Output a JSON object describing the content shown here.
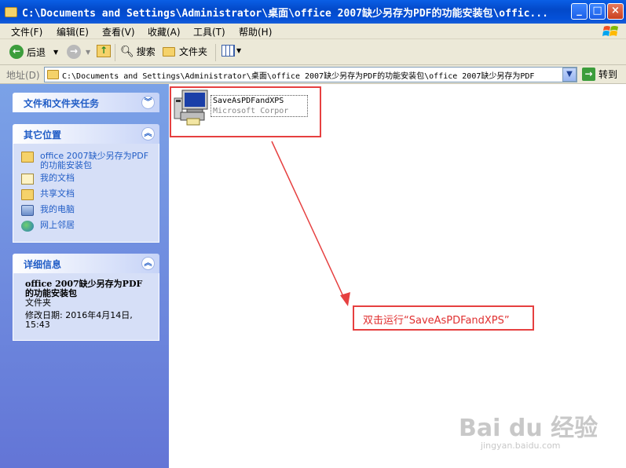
{
  "window": {
    "title": "C:\\Documents and Settings\\Administrator\\桌面\\office 2007缺少另存为PDF的功能安装包\\offic...",
    "minimize": "_",
    "maximize": "□",
    "close": "×"
  },
  "menu": [
    "文件(F)",
    "编辑(E)",
    "查看(V)",
    "收藏(A)",
    "工具(T)",
    "帮助(H)"
  ],
  "toolbar": {
    "back": "后退",
    "search": "搜索",
    "folders": "文件夹"
  },
  "address": {
    "label": "地址(D)",
    "path": "C:\\Documents and Settings\\Administrator\\桌面\\office 2007缺少另存为PDF的功能安装包\\office 2007缺少另存为PDF",
    "go": "转到"
  },
  "sidebar": {
    "tasks": {
      "title": "文件和文件夹任务"
    },
    "places": {
      "title": "其它位置",
      "items": [
        "office 2007缺少另存为PDF的功能安装包",
        "我的文档",
        "共享文档",
        "我的电脑",
        "网上邻居"
      ]
    },
    "details": {
      "title": "详细信息",
      "name": "office 2007缺少另存为PDF的功能安装包",
      "type": "文件夹",
      "modified": "修改日期: 2016年4月14日, 15:43"
    }
  },
  "file": {
    "name": "SaveAsPDFandXPS",
    "company": "Microsoft Corpor"
  },
  "annotation": {
    "text": "双击运行“SaveAsPDFandXPS”",
    "color": "#e64040"
  },
  "watermark": {
    "brand": "Bai du 经验",
    "url": "jingyan.baidu.com"
  }
}
